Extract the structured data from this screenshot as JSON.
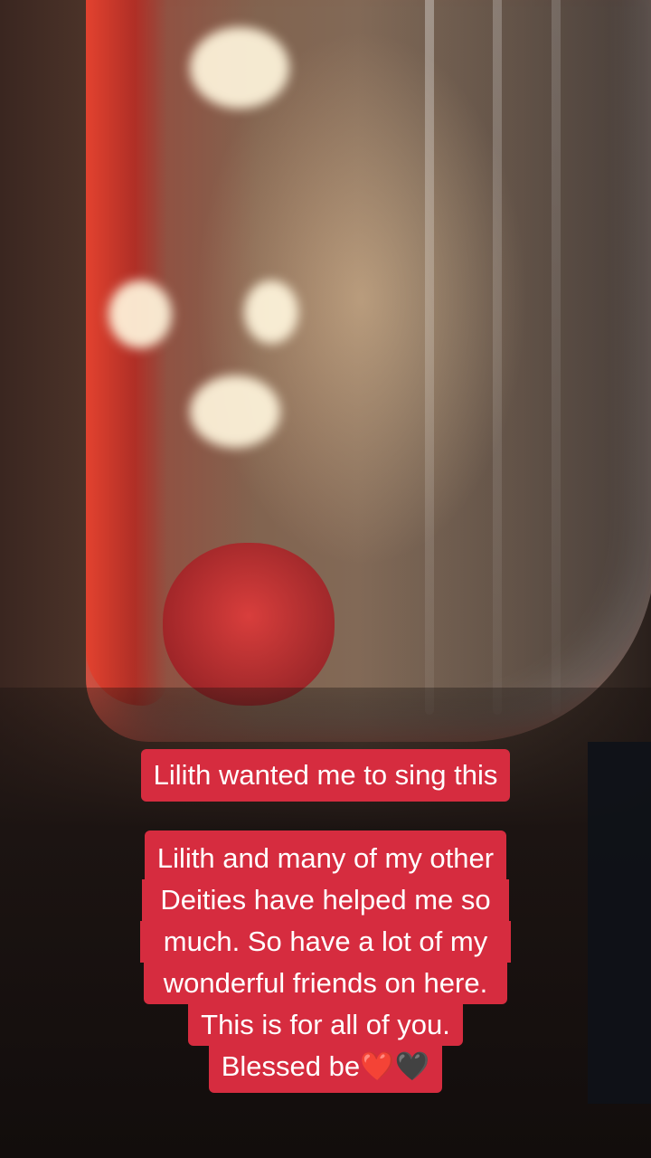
{
  "captions": {
    "top": "Lilith wanted me to sing this",
    "bottom_lines": [
      "Lilith and many of my other",
      "Deities have helped me so",
      "much. So have a lot of my",
      "wonderful friends on here.",
      "This is for all of you.",
      "Blessed be❤️🖤"
    ]
  },
  "colors": {
    "caption_background": "#d62c3f",
    "caption_text": "#ffffff"
  }
}
